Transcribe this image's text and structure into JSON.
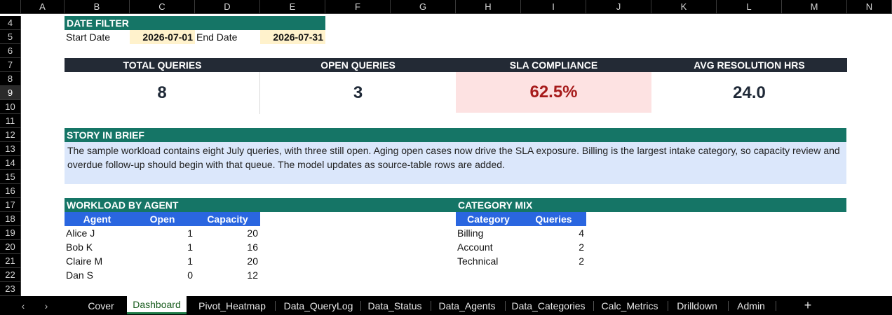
{
  "columns": [
    "A",
    "B",
    "C",
    "D",
    "E",
    "F",
    "G",
    "H",
    "I",
    "J",
    "K",
    "L",
    "M",
    "N"
  ],
  "rows": [
    "4",
    "5",
    "6",
    "7",
    "8",
    "9",
    "10",
    "11",
    "12",
    "13",
    "14",
    "15",
    "16",
    "17",
    "18",
    "19",
    "20",
    "21",
    "22",
    "23"
  ],
  "selected_row": "9",
  "date_filter": {
    "title": "DATE FILTER",
    "start_label": "Start Date",
    "start_value": "2026-07-01",
    "end_label": "End Date",
    "end_value": "2026-07-31"
  },
  "kpis": [
    {
      "label": "TOTAL QUERIES",
      "value": "8"
    },
    {
      "label": "OPEN QUERIES",
      "value": "3"
    },
    {
      "label": "SLA COMPLIANCE",
      "value": "62.5%"
    },
    {
      "label": "AVG RESOLUTION HRS",
      "value": "24.0"
    }
  ],
  "story": {
    "title": "STORY IN BRIEF",
    "text": "The sample workload contains eight July queries, with three still open. Aging open cases now drive the SLA exposure. Billing is the largest intake category, so capacity review and overdue follow-up should begin with that queue. The model updates as source-table rows are added."
  },
  "workload": {
    "title": "WORKLOAD BY AGENT",
    "headers": [
      "Agent",
      "Open",
      "Capacity"
    ],
    "rows": [
      [
        "Alice J",
        "1",
        "20"
      ],
      [
        "Bob K",
        "1",
        "16"
      ],
      [
        "Claire M",
        "1",
        "20"
      ],
      [
        "Dan S",
        "0",
        "12"
      ]
    ]
  },
  "category_mix": {
    "title": "CATEGORY MIX",
    "headers": [
      "Category",
      "Queries"
    ],
    "rows": [
      [
        "Billing",
        "4"
      ],
      [
        "Account",
        "2"
      ],
      [
        "Technical",
        "2"
      ]
    ]
  },
  "tabs": {
    "nav_prev": "‹",
    "nav_next": "›",
    "items": [
      "Cover",
      "Dashboard",
      "Pivot_Heatmap",
      "Data_QueryLog",
      "Data_Status",
      "Data_Agents",
      "Data_Categories",
      "Calc_Metrics",
      "Drilldown",
      "Admin"
    ],
    "active": "Dashboard",
    "add": "+"
  },
  "colors": {
    "teal": "#157566",
    "dark_header": "#232a35",
    "date_fill": "#fff2cc",
    "table_header": "#2a66e0",
    "story_fill": "#dbe7fb",
    "sla_fill": "#fde2e2",
    "sla_text": "#a61b1b"
  }
}
